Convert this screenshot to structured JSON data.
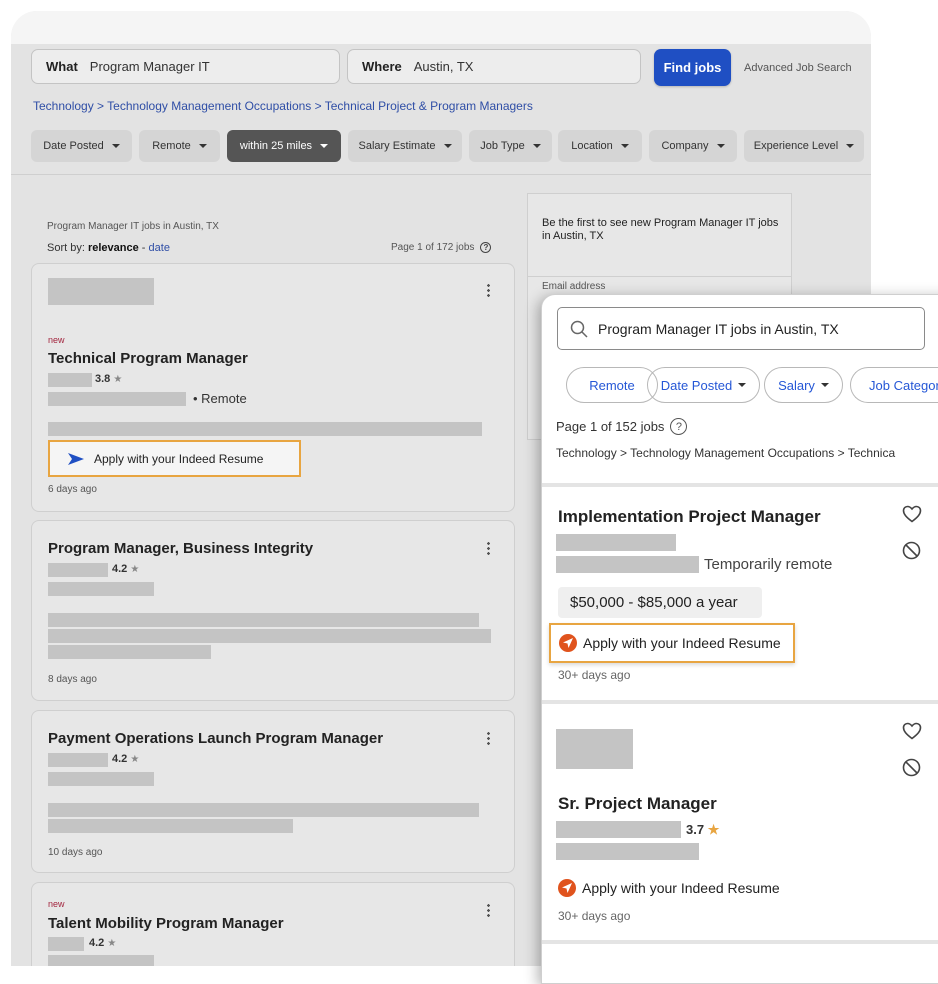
{
  "search": {
    "what_label": "What",
    "what_value": "Program Manager IT",
    "where_label": "Where",
    "where_value": "Austin, TX",
    "find_button": "Find jobs",
    "advanced_link": "Advanced Job Search"
  },
  "breadcrumb": "Technology > Technology Management Occupations > Technical Project & Program Managers",
  "filters": [
    {
      "label": "Date Posted",
      "active": false
    },
    {
      "label": "Remote",
      "active": false
    },
    {
      "label": "within 25 miles",
      "active": true
    },
    {
      "label": "Salary Estimate",
      "active": false
    },
    {
      "label": "Job Type",
      "active": false
    },
    {
      "label": "Location",
      "active": false
    },
    {
      "label": "Company",
      "active": false
    },
    {
      "label": "Experience Level",
      "active": false
    }
  ],
  "results": {
    "heading": "Program Manager IT jobs in Austin, TX",
    "sort_prefix": "Sort by:",
    "sort_active": "relevance",
    "sort_separator": "-",
    "sort_alt": "date",
    "page_info": "Page 1 of 172 jobs"
  },
  "jobs": [
    {
      "new_tag": "new",
      "title": "Technical Program Manager",
      "rating": "3.8",
      "location": "Remote",
      "apply": "Apply with your Indeed Resume",
      "posted": "6 days ago"
    },
    {
      "new_tag": "",
      "title": "Program Manager, Business Integrity",
      "rating": "4.2",
      "posted": "8 days ago"
    },
    {
      "new_tag": "",
      "title": "Payment Operations Launch Program Manager",
      "rating": "4.2",
      "posted": "10 days ago"
    },
    {
      "new_tag": "new",
      "title": "Talent Mobility Program Manager",
      "rating": "4.2",
      "posted": ""
    }
  ],
  "alert": {
    "text": "Be the first to see new Program Manager IT jobs in Austin, TX",
    "email_label": "Email address"
  },
  "mobile": {
    "search_value": "Program Manager IT jobs in Austin, TX",
    "chips": [
      "Remote",
      "Date Posted",
      "Salary",
      "Job Category"
    ],
    "page_info": "Page 1 of 152 jobs",
    "breadcrumb": "Technology > Technology Management Occupations > Technica",
    "jobs": [
      {
        "title": "Implementation Project Manager",
        "location": "Temporarily remote",
        "salary": "$50,000 - $85,000 a year",
        "apply": "Apply with your Indeed Resume",
        "posted": "30+ days ago"
      },
      {
        "title": "Sr. Project Manager",
        "rating": "3.7",
        "apply": "Apply with your Indeed Resume",
        "posted": "30+ days ago"
      }
    ]
  },
  "star_glyph": "★",
  "colors": {
    "accent_blue": "#1f4fc3",
    "highlight_orange": "#e8a541",
    "indeed_orange": "#e0531d"
  }
}
